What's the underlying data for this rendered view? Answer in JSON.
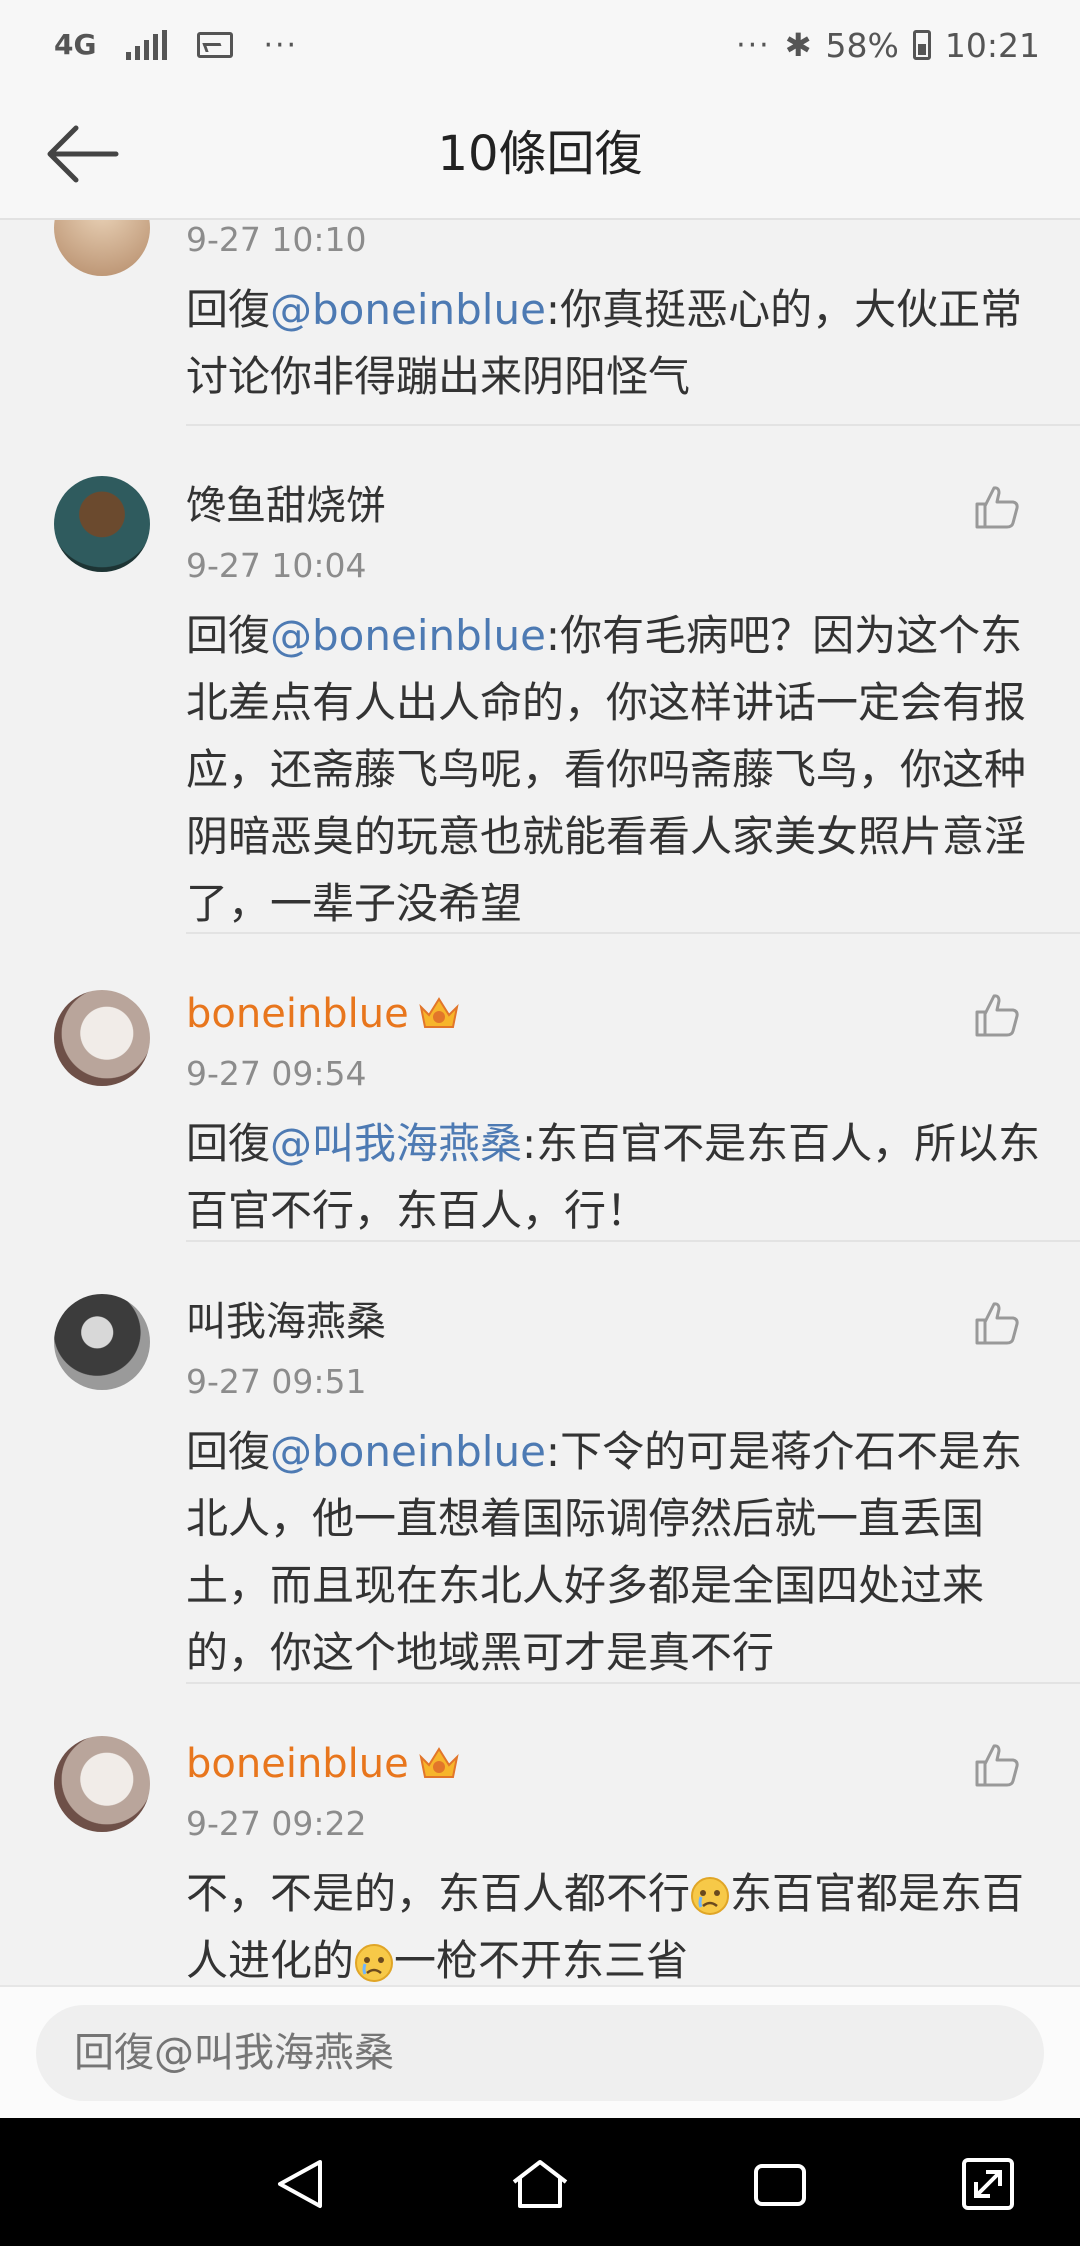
{
  "status_bar": {
    "network": "4G",
    "more": "···",
    "bluetooth": "✱",
    "battery": "58%",
    "time": "10:21"
  },
  "header": {
    "title": "10條回復"
  },
  "comments": [
    {
      "time": "9-27 10:10",
      "reply_prefix": "回復",
      "mention": "@boneinblue",
      "body": ":你真挺恶心的，大伙正常讨论你非得蹦出来阴阳怪气"
    },
    {
      "name": "馋鱼甜烧饼",
      "time": "9-27 10:04",
      "reply_prefix": "回復",
      "mention": "@boneinblue",
      "body": ":你有毛病吧？因为这个东北差点有人出人命的，你这样讲话一定会有报应，还斋藤飞鸟呢，看你吗斋藤飞鸟，你这种阴暗恶臭的玩意也就能看看人家美女照片意淫了，一辈子没希望"
    },
    {
      "name": "boneinblue",
      "time": "9-27 09:54",
      "reply_prefix": "回復",
      "mention": "@叫我海燕桑",
      "body": ":东百官不是东百人，所以东百官不行，东百人，行！"
    },
    {
      "name": "叫我海燕桑",
      "time": "9-27 09:51",
      "reply_prefix": "回復",
      "mention": "@boneinblue",
      "body": ":下令的可是蒋介石不是东北人，他一直想着国际调停然后就一直丢国土，而且现在东北人好多都是全国四处过来的，你这个地域黑可才是真不行"
    },
    {
      "name": "boneinblue",
      "time": "9-27 09:22",
      "body_part1": "不，不是的，东百人都不行",
      "body_part2": "东百官都是东百人进化的",
      "body_part3": "一枪不开东三省"
    }
  ],
  "input": {
    "placeholder": "回復@叫我海燕桑"
  },
  "icons": {
    "back": "arrow-left-icon",
    "like": "thumbs-up-icon",
    "vip": "crown-badge-icon",
    "emoji": "crying-face-emoji"
  },
  "colors": {
    "mention": "#4d7ab3",
    "vip_name": "#e8761d",
    "timestamp": "#8c8c8c"
  }
}
